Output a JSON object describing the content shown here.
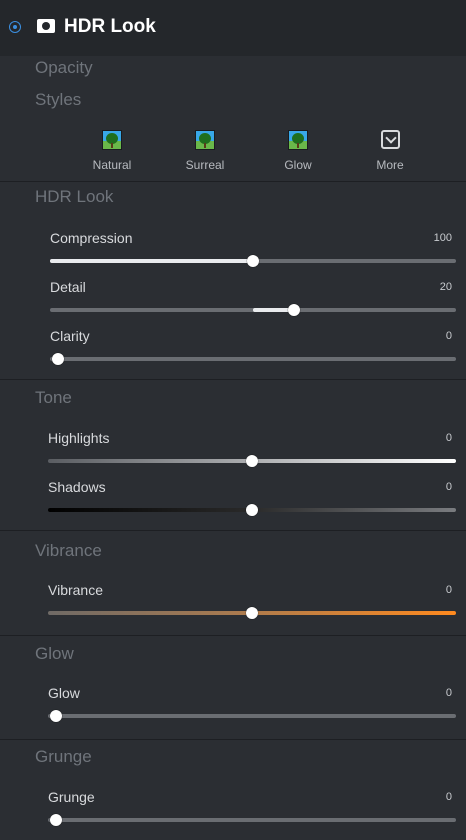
{
  "header": {
    "title": "HDR Look",
    "radio_icon": "radio-selected-icon",
    "mask_icon": "mask-icon",
    "accent": "#3b8fe0"
  },
  "labels": {
    "opacity": "Opacity",
    "styles": "Styles"
  },
  "styles": [
    {
      "label": "Natural",
      "icon": "tree-thumbnail-icon"
    },
    {
      "label": "Surreal",
      "icon": "tree-thumbnail-icon"
    },
    {
      "label": "Glow",
      "icon": "tree-thumbnail-icon"
    },
    {
      "label": "More",
      "icon": "chevron-down-box-icon"
    }
  ],
  "sections": {
    "hdr_look": {
      "title": "HDR Look",
      "sliders": [
        {
          "label": "Compression",
          "value": "100",
          "position": 0.5
        },
        {
          "label": "Detail",
          "value": "20",
          "position": 0.6
        },
        {
          "label": "Clarity",
          "value": "0",
          "position": 0.02
        }
      ]
    },
    "tone": {
      "title": "Tone",
      "sliders": [
        {
          "label": "Highlights",
          "value": "0",
          "position": 0.5
        },
        {
          "label": "Shadows",
          "value": "0",
          "position": 0.5
        }
      ]
    },
    "vibrance": {
      "title": "Vibrance",
      "sliders": [
        {
          "label": "Vibrance",
          "value": "0",
          "position": 0.5
        }
      ]
    },
    "glow": {
      "title": "Glow",
      "sliders": [
        {
          "label": "Glow",
          "value": "0",
          "position": 0.02
        }
      ]
    },
    "grunge": {
      "title": "Grunge",
      "sliders": [
        {
          "label": "Grunge",
          "value": "0",
          "position": 0.02
        }
      ]
    }
  },
  "colors": {
    "panel": "#2b2e33",
    "header": "#24272b",
    "muted_text": "#6f747b",
    "vibrance_end": "#ff8a1f"
  }
}
